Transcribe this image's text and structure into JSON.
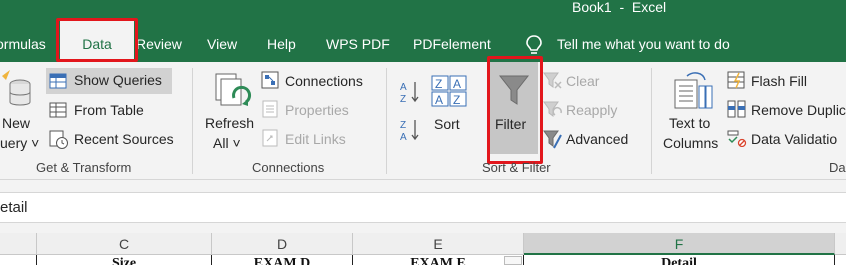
{
  "window": {
    "title": "Book1  -  Excel"
  },
  "tabs": [
    {
      "label": "ormulas"
    },
    {
      "label": "Data"
    },
    {
      "label": "Review"
    },
    {
      "label": "View"
    },
    {
      "label": "Help"
    },
    {
      "label": "WPS PDF"
    },
    {
      "label": "PDFelement"
    }
  ],
  "tell_me": {
    "label": "Tell me what you want to do"
  },
  "get_transform": {
    "new_query": {
      "line1": "New",
      "line2": "uery ˅"
    },
    "show_queries": "Show Queries",
    "from_table": "From Table",
    "recent_sources": "Recent Sources",
    "group_label": "Get & Transform"
  },
  "connections": {
    "refresh_all": {
      "line1": "Refresh",
      "line2": "All ˅"
    },
    "connections": "Connections",
    "properties": "Properties",
    "edit_links": "Edit Links",
    "group_label": "Connections"
  },
  "sort_filter": {
    "sort": "Sort",
    "filter": "Filter",
    "clear": "Clear",
    "reapply": "Reapply",
    "advanced": "Advanced",
    "group_label": "Sort & Filter"
  },
  "data_tools": {
    "text_to_columns": {
      "line1": "Text to",
      "line2": "Columns"
    },
    "flash_fill": "Flash Fill",
    "remove_duplicates": "Remove Duplic",
    "data_validation": "Data Validatio",
    "group_label": "Da"
  },
  "formula_bar": {
    "text": "etail"
  },
  "columns": [
    "C",
    "D",
    "E",
    "F"
  ],
  "header_row": [
    "Size",
    "EXAM D",
    "EXAM E",
    "Detail"
  ],
  "colors": {
    "excel_green": "#217346",
    "highlight_red": "#e2161c"
  }
}
